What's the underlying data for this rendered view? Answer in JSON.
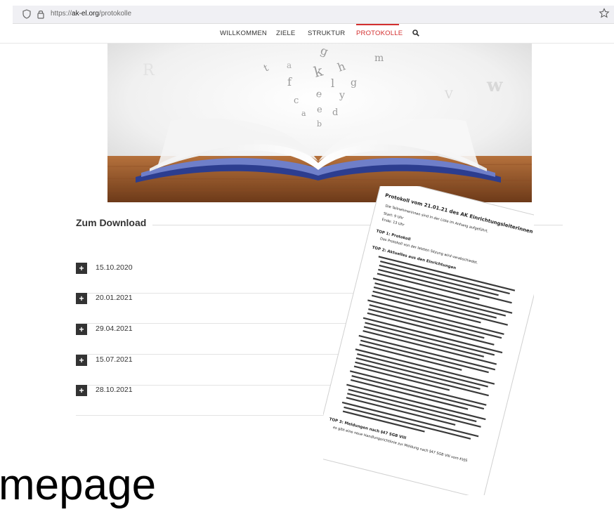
{
  "browser": {
    "url_prefix": "https://",
    "url_domain": "ak-el.org",
    "url_path": "/protokolle"
  },
  "nav": {
    "items": [
      "WILLKOMMEN",
      "ZIELE",
      "STRUKTUR",
      "PROTOKOLLE"
    ],
    "active": "PROTOKOLLE",
    "accent_color": "#d32f2f"
  },
  "hero": {
    "letters": [
      "g",
      "h",
      "m",
      "a",
      "t",
      "k",
      "l",
      "g",
      "f",
      "e",
      "y",
      "c",
      "e",
      "d",
      "a",
      "b",
      "w",
      "V",
      "R"
    ]
  },
  "download": {
    "title": "Zum Download",
    "dates": [
      "15.10.2020",
      "20.01.2021",
      "29.04.2021",
      "15.07.2021",
      "28.10.2021"
    ]
  },
  "document": {
    "title": "Protokoll vom 21.01.21 des AK Einrichtungsleiterinnen",
    "intro": "Die Teilnehmerinnen sind in der Liste im Anhang aufgeführt.",
    "start": "Start: 9 Uhr",
    "end": "Ende: 13 Uhr",
    "top1": "TOP 1: Protokoll",
    "top1_text": "Das Protokoll von der letzten Sitzung wird verabschiedet.",
    "top2": "TOP 2: Aktuelles aus den Einrichtungen",
    "top3": "TOP 3: Meldungen nach §47 SGB VIII",
    "top3_text": "es gibt eine neue Handlungsrichtlinie zur Meldung nach §47 SGB VIII vom KVJS"
  },
  "overlay_text": "mepage"
}
